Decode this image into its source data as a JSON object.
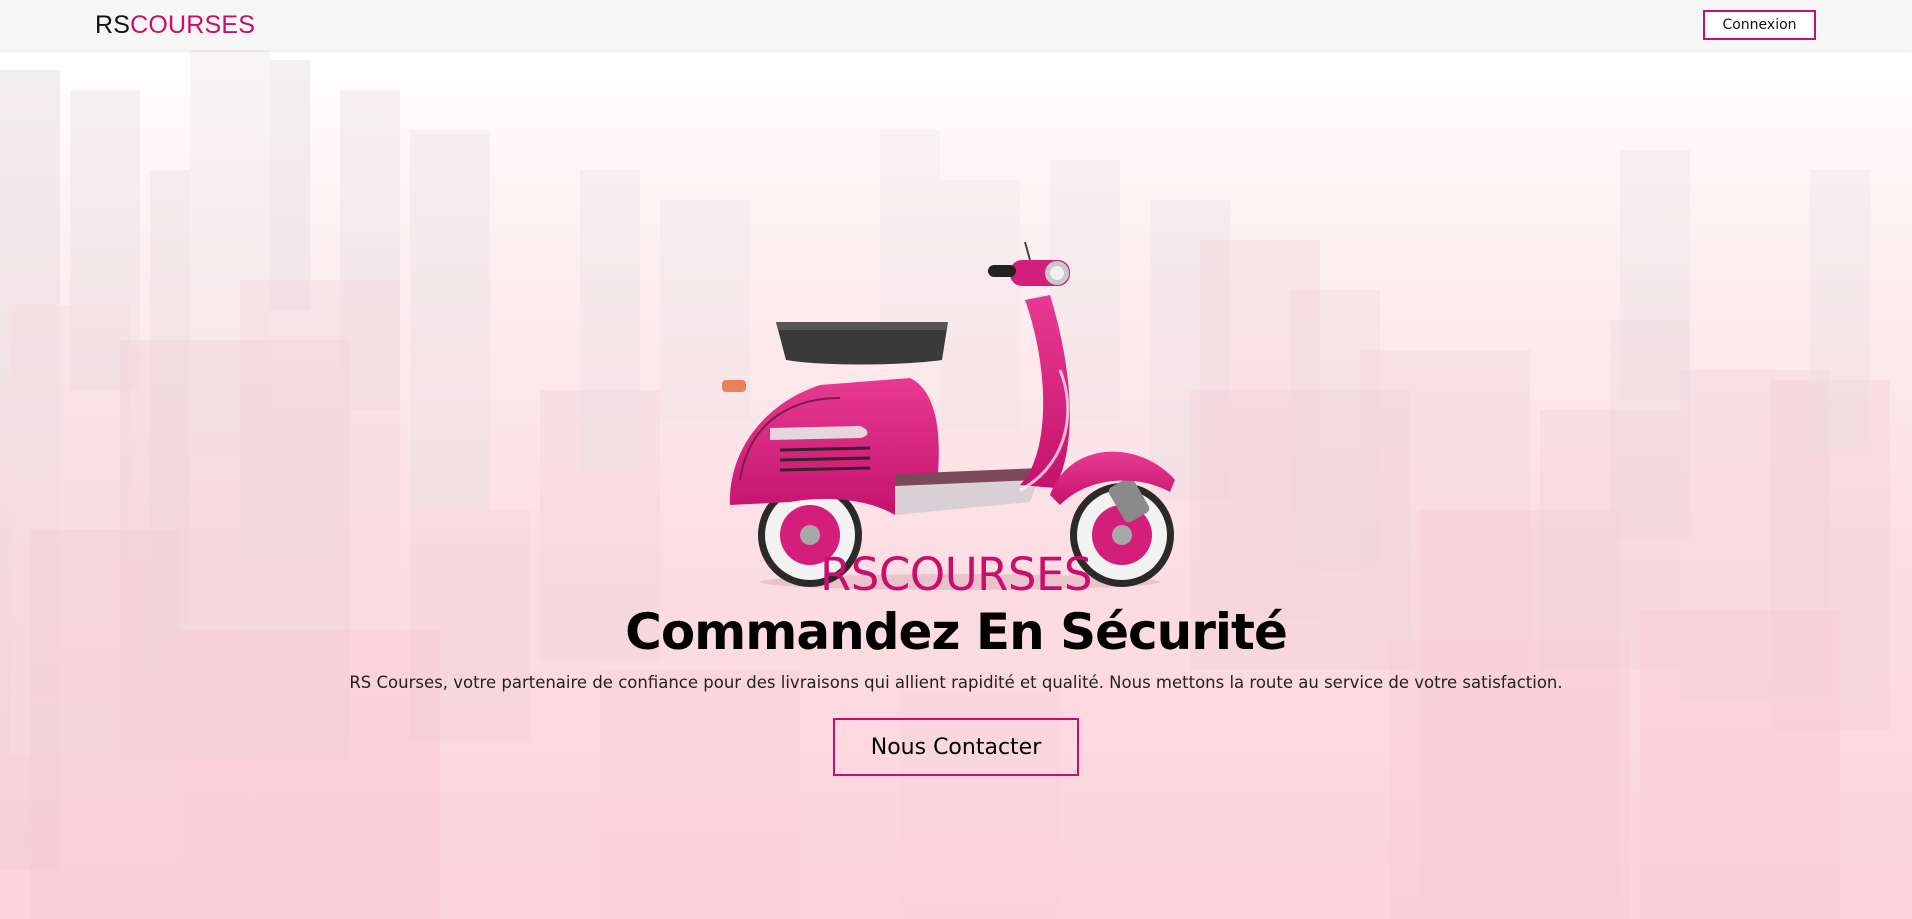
{
  "navbar": {
    "logo_dark": "RS",
    "logo_accent": "COURSES",
    "login_label": "Connexion"
  },
  "hero": {
    "brand": "RSCOURSES",
    "headline": "Commandez En Sécurité",
    "tagline": "RS Courses, votre partenaire de confiance pour des livraisons qui allient rapidité et qualité. Nous mettons la route au service de votre satisfaction.",
    "cta_label": "Nous Contacter"
  },
  "colors": {
    "accent": "#c80f6b",
    "navbar_bg": "#f6f6f6",
    "hero_bg": "#fcdde3"
  }
}
